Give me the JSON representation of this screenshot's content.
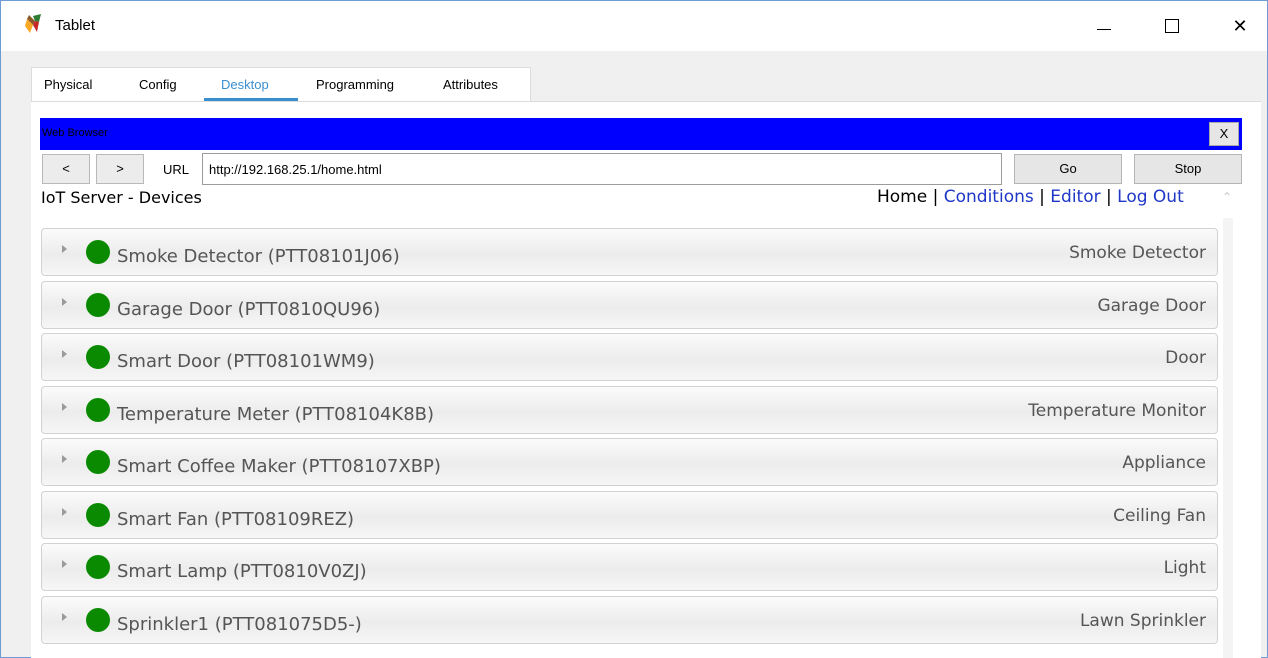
{
  "window": {
    "title": "Tablet",
    "icon": "packet-tracer-tablet-icon",
    "controls": {
      "minimize": "—",
      "maximize": "☐",
      "close": "✕"
    }
  },
  "tabs": [
    {
      "label": "Physical"
    },
    {
      "label": "Config"
    },
    {
      "label": "Desktop",
      "active": true
    },
    {
      "label": "Programming"
    },
    {
      "label": "Attributes"
    }
  ],
  "browser": {
    "title": "Web Browser",
    "close_label": "X",
    "back_label": "<",
    "forward_label": ">",
    "url_label": "URL",
    "url": "http://192.168.25.1/home.html",
    "go_label": "Go",
    "stop_label": "Stop"
  },
  "page": {
    "heading": "IoT Server - Devices",
    "links": {
      "home": "Home",
      "sep1": " | ",
      "conditions": "Conditions",
      "sep2": " | ",
      "editor": "Editor",
      "sep3": " | ",
      "logout": "Log Out"
    }
  },
  "devices": [
    {
      "name": "Smoke Detector (PTT08101J06)",
      "type": "Smoke Detector",
      "status_color": "#0a8a00"
    },
    {
      "name": "Garage Door (PTT0810QU96)",
      "type": "Garage Door",
      "status_color": "#0a8a00"
    },
    {
      "name": "Smart Door (PTT08101WM9)",
      "type": "Door",
      "status_color": "#0a8a00"
    },
    {
      "name": "Temperature Meter (PTT08104K8B)",
      "type": "Temperature Monitor",
      "status_color": "#0a8a00"
    },
    {
      "name": "Smart Coffee Maker (PTT08107XBP)",
      "type": "Appliance",
      "status_color": "#0a8a00"
    },
    {
      "name": "Smart Fan (PTT08109REZ)",
      "type": "Ceiling Fan",
      "status_color": "#0a8a00"
    },
    {
      "name": "Smart Lamp (PTT0810V0ZJ)",
      "type": "Light",
      "status_color": "#0a8a00"
    },
    {
      "name": "Sprinkler1 (PTT081075D5-)",
      "type": "Lawn Sprinkler",
      "status_color": "#0a8a00"
    }
  ],
  "colors": {
    "browser_bar": "#0000ff",
    "active_tab": "#3a8fd0",
    "link": "#1e37c7",
    "status_on": "#0a8a00"
  }
}
